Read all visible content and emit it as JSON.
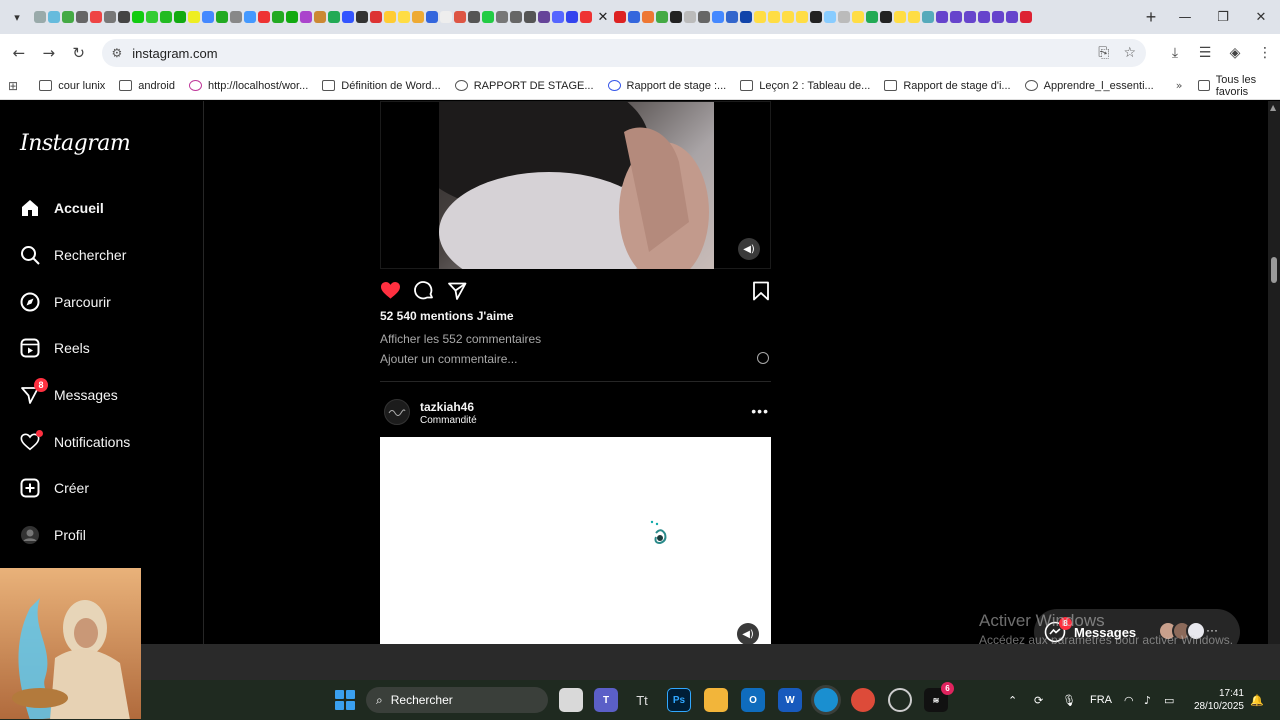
{
  "browser": {
    "url": "instagram.com",
    "bookmarks": [
      {
        "label": "cour lunix",
        "icon": "folder-icon"
      },
      {
        "label": "android",
        "icon": "folder-icon"
      },
      {
        "label": "http://localhost/wor...",
        "icon": "localhost-icon"
      },
      {
        "label": "Définition de Word...",
        "icon": "page-icon"
      },
      {
        "label": "RAPPORT DE STAGE...",
        "icon": "globe-icon"
      },
      {
        "label": "Rapport de stage :...",
        "icon": "wordpress-icon"
      },
      {
        "label": "Leçon 2 : Tableau de...",
        "icon": "page-icon"
      },
      {
        "label": "Rapport de stage d'i...",
        "icon": "page-icon"
      },
      {
        "label": "Apprendre_l_essenti...",
        "icon": "globe-icon"
      }
    ],
    "all_bookmarks": "Tous les favoris"
  },
  "instagram": {
    "logo": "Instagram",
    "nav": [
      {
        "label": "Accueil",
        "icon": "home-icon",
        "active": true
      },
      {
        "label": "Rechercher",
        "icon": "search-icon"
      },
      {
        "label": "Parcourir",
        "icon": "compass-icon"
      },
      {
        "label": "Reels",
        "icon": "reels-icon"
      },
      {
        "label": "Messages",
        "icon": "messenger-icon",
        "badge": "8"
      },
      {
        "label": "Notifications",
        "icon": "heart-icon"
      },
      {
        "label": "Créer",
        "icon": "plus-square-icon"
      },
      {
        "label": "Profil",
        "icon": "profile-icon"
      }
    ],
    "post1": {
      "likes": "52 540 mentions J'aime",
      "view_comments": "Afficher les 552 commentaires",
      "add_comment": "Ajouter un commentaire..."
    },
    "post2": {
      "username": "tazkiah46",
      "sponsored": "Commandité"
    },
    "messages_pill": {
      "label": "Messages",
      "badge": "8"
    }
  },
  "watermark": {
    "title": "Activer Windows",
    "subtitle": "Accédez aux paramètres pour activer Windows."
  },
  "taskbar": {
    "search": "Rechercher",
    "language": "FRA",
    "time": "17:41",
    "date": "28/10/2025",
    "badge_app": "6"
  }
}
